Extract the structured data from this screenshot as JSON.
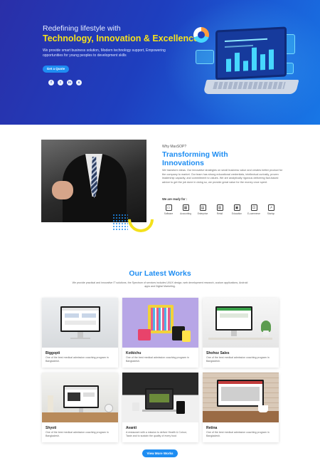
{
  "hero": {
    "subtitle": "Redefining lifestyle with",
    "title": "Technology, Innovation & Excellence",
    "description": "We provide smart business solution, Modern technology support, Empowering opportunities for young peoples to development skills",
    "cta_label": "Get a Quote",
    "socials": [
      {
        "icon": "facebook-icon",
        "glyph": "f"
      },
      {
        "icon": "twitter-icon",
        "glyph": "t"
      },
      {
        "icon": "linkedin-icon",
        "glyph": "in"
      },
      {
        "icon": "skype-icon",
        "glyph": "s"
      }
    ]
  },
  "about": {
    "kicker": "Why MaxSOP?",
    "title": "Transforming With Innovations",
    "description": "We transform ideas. Our innovative strategies on small business value and creates better product for the company to market. Our team has strong educational credentials, intellectual curiosity, proven leadership capacity, and commitment to values. We are analytically rigorous delivering fact-based advice to get the job done in doing so, we provide great value for the money once spent.",
    "ready_label": "We are ready for :",
    "services": [
      {
        "label": "Software",
        "glyph": "▭"
      },
      {
        "label": "Accounting",
        "glyph": "▦"
      },
      {
        "label": "Enterprise",
        "glyph": "▤"
      },
      {
        "label": "Retail",
        "glyph": "▥"
      },
      {
        "label": "Education",
        "glyph": "▣"
      },
      {
        "label": "E-commerce",
        "glyph": "⊡"
      },
      {
        "label": "Startup",
        "glyph": "↗"
      }
    ]
  },
  "works": {
    "title": "Our Latest Works",
    "description": "We provide practical and innovative IT solutions, the Spectrum of services includes UI/UX design, web development research, custom applications, Android apps and Digital Marketing.",
    "items": [
      {
        "name": "Biggopti",
        "desc": "One of the best medical admission coaching program in Bangladesh."
      },
      {
        "name": "Kotkichu",
        "desc": "One of the best medical admission coaching program in Bangladesh."
      },
      {
        "name": "Shohoz Sales",
        "desc": "One of the best medical admission coaching program in Bangladesh."
      },
      {
        "name": "Shyoti",
        "desc": "One of the best medical admission coaching program in Bangladesh."
      },
      {
        "name": "Avanti",
        "desc": "A restaurant with a mission to deliver Health & Colour, Taste and to sustain the quality of every food"
      },
      {
        "name": "Retina",
        "desc": "One of the best medical admission coaching program in Bangladesh."
      }
    ],
    "view_more_label": "View More Works"
  }
}
